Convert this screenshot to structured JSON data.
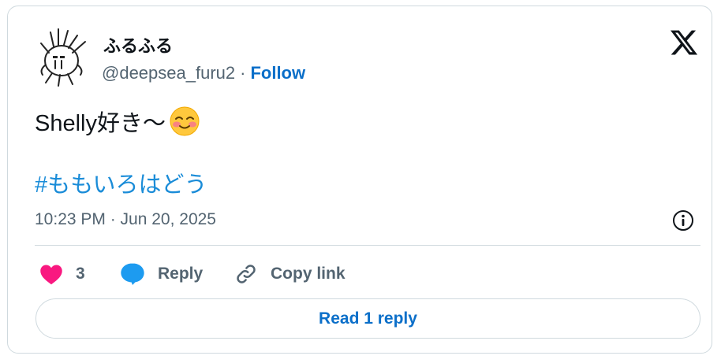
{
  "user": {
    "display_name": "ふるふる",
    "handle": "@deepsea_furu2",
    "separator": "·",
    "follow_label": "Follow",
    "avatar_icon": "sketch-character-avatar"
  },
  "brand": {
    "logo_icon": "x-logo-icon"
  },
  "tweet": {
    "text": "Shelly好き〜",
    "emoji_icon": "smiling-face-with-blush-emoji",
    "hashtag": "#ももいろはどう",
    "timestamp": "10:23 PM · Jun 20, 2025"
  },
  "actions": {
    "like_count": "3",
    "reply_label": "Reply",
    "copy_link_label": "Copy link",
    "read_reply_label": "Read 1 reply"
  },
  "colors": {
    "like": "#f91880",
    "reply_icon": "#1d9bf0",
    "link": "#0b6fc9",
    "muted": "#536471",
    "border": "#cfd9de"
  }
}
